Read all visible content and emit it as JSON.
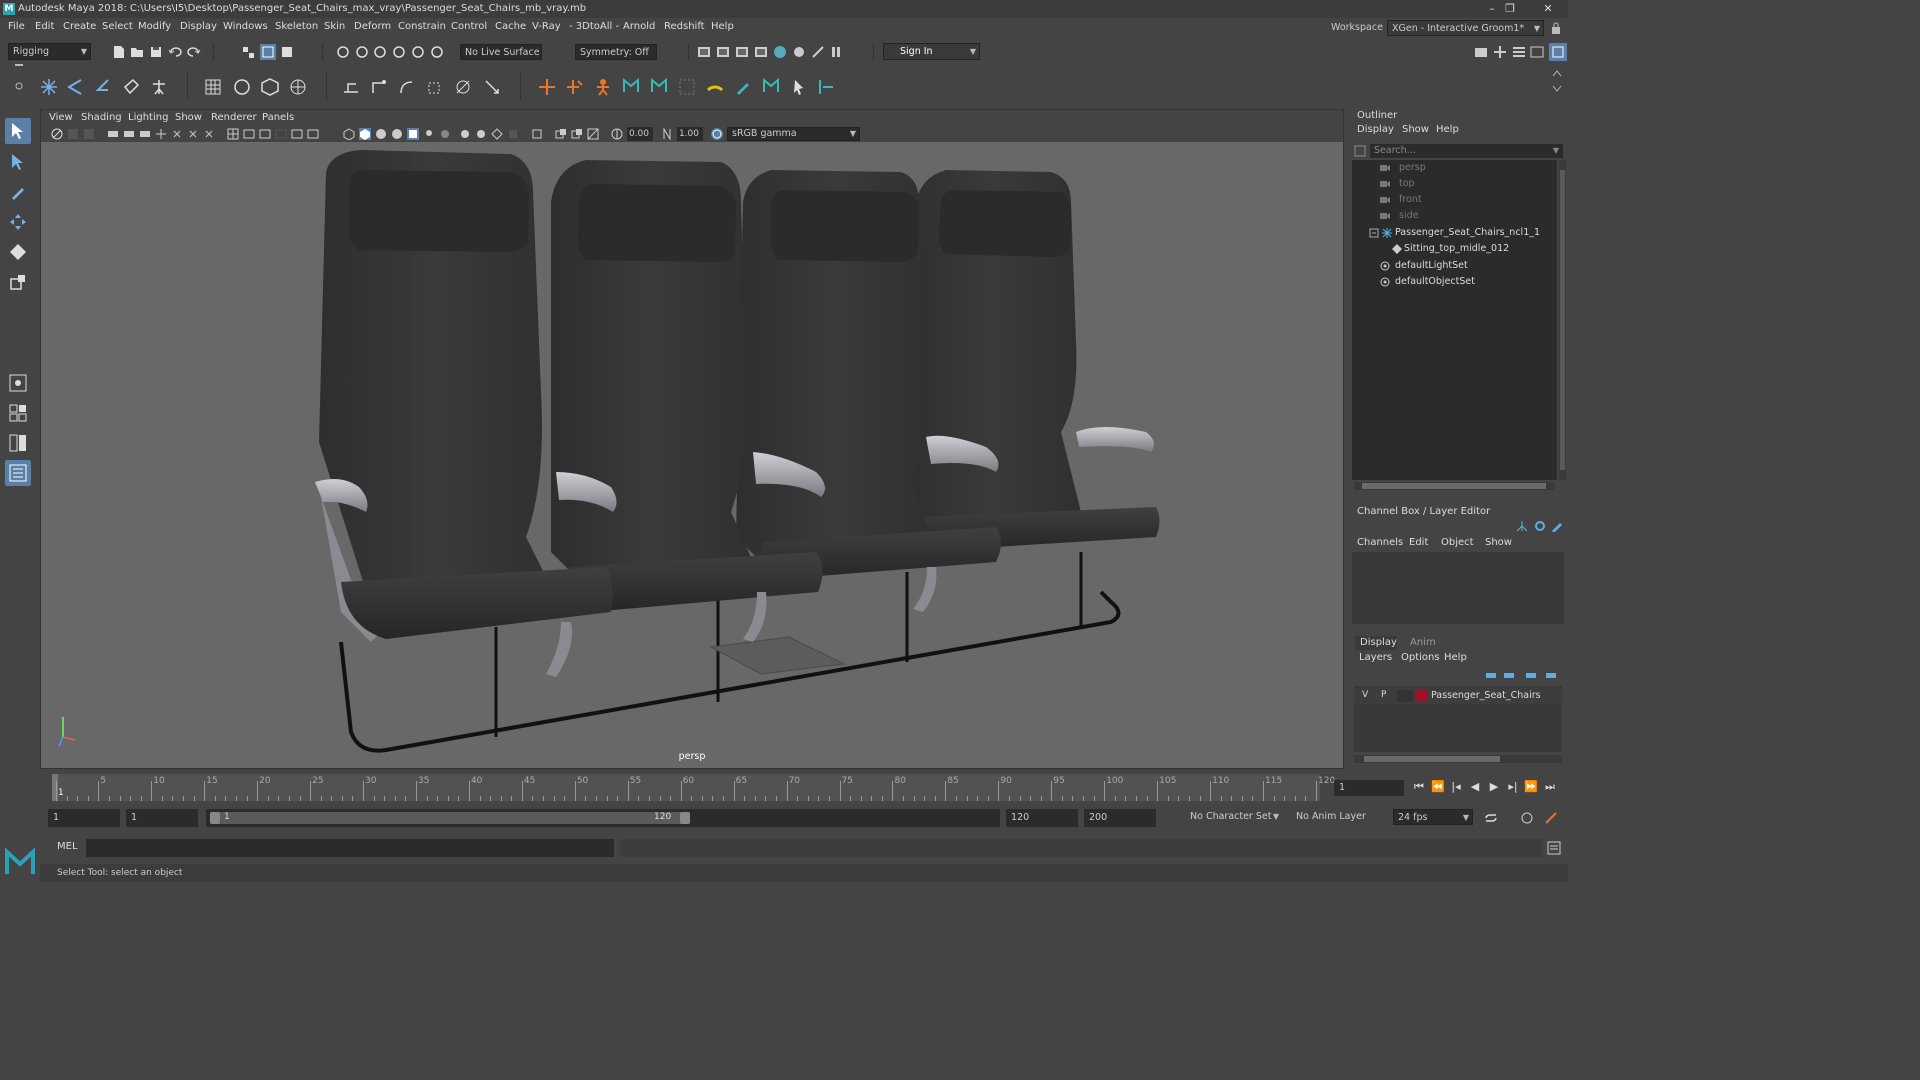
{
  "title": {
    "text": "Autodesk Maya 2018: C:\\Users\\I5\\Desktop\\Passenger_Seat_Chairs_max_vray\\Passenger_Seat_Chairs_mb_vray.mb"
  },
  "window_controls": {
    "minimize": "–",
    "restore": "❐",
    "close": "✕"
  },
  "menu": [
    "File",
    "Edit",
    "Create",
    "Select",
    "Modify",
    "Display",
    "Windows",
    "Skeleton",
    "Skin",
    "Deform",
    "Constrain",
    "Control",
    "Cache",
    "V-Ray",
    "3DtoAll",
    "Arnold",
    "Redshift",
    "Help"
  ],
  "workspace": {
    "label": "Workspace :",
    "value": "XGen - Interactive Groom1*"
  },
  "statusline": {
    "mode": "Rigging",
    "live_surface": "No Live Surface",
    "symmetry": "Symmetry: Off",
    "sign_in": "Sign In"
  },
  "viewport": {
    "menu": [
      "View",
      "Shading",
      "Lighting",
      "Show",
      "Renderer",
      "Panels"
    ],
    "exposure": "0.00",
    "gamma": "1.00",
    "color_space": "sRGB gamma",
    "camera_label": "persp"
  },
  "outliner": {
    "title": "Outliner",
    "menu": [
      "Display",
      "Show",
      "Help"
    ],
    "search_placeholder": "Search...",
    "items": [
      {
        "label": "persp",
        "dim": true
      },
      {
        "label": "top",
        "dim": true
      },
      {
        "label": "front",
        "dim": true
      },
      {
        "label": "side",
        "dim": true
      },
      {
        "label": "Passenger_Seat_Chairs_ncl1_1",
        "dim": false
      },
      {
        "label": "Sitting_top_midle_012",
        "dim": false
      },
      {
        "label": "defaultLightSet",
        "dim": false
      },
      {
        "label": "defaultObjectSet",
        "dim": false
      }
    ]
  },
  "channel_box": {
    "title": "Channel Box / Layer Editor",
    "menu": [
      "Channels",
      "Edit",
      "Object",
      "Show"
    ],
    "tabs": [
      "Display",
      "Anim"
    ],
    "layer_menu": [
      "Layers",
      "Options",
      "Help"
    ],
    "layer": {
      "v": "V",
      "p": "P",
      "name": "Passenger_Seat_Chairs",
      "color": "#a0102a"
    }
  },
  "timeline": {
    "ticks": [
      "1",
      "5",
      "10",
      "15",
      "20",
      "25",
      "30",
      "35",
      "40",
      "45",
      "50",
      "55",
      "60",
      "65",
      "70",
      "75",
      "80",
      "85",
      "90",
      "95",
      "100",
      "105",
      "110",
      "115",
      "120"
    ],
    "current_frame": "1"
  },
  "range": {
    "start": "1",
    "anim_start": "1",
    "slider_start": "1",
    "slider_end": "120",
    "end": "120",
    "anim_end": "200",
    "character_set": "No Character Set",
    "anim_layer": "No Anim Layer",
    "fps": "24 fps"
  },
  "mel": {
    "label": "MEL"
  },
  "help_line": "Select Tool: select an object",
  "colors": {
    "accent": "#5b9bd5",
    "highlight": "#3f6e9e"
  }
}
